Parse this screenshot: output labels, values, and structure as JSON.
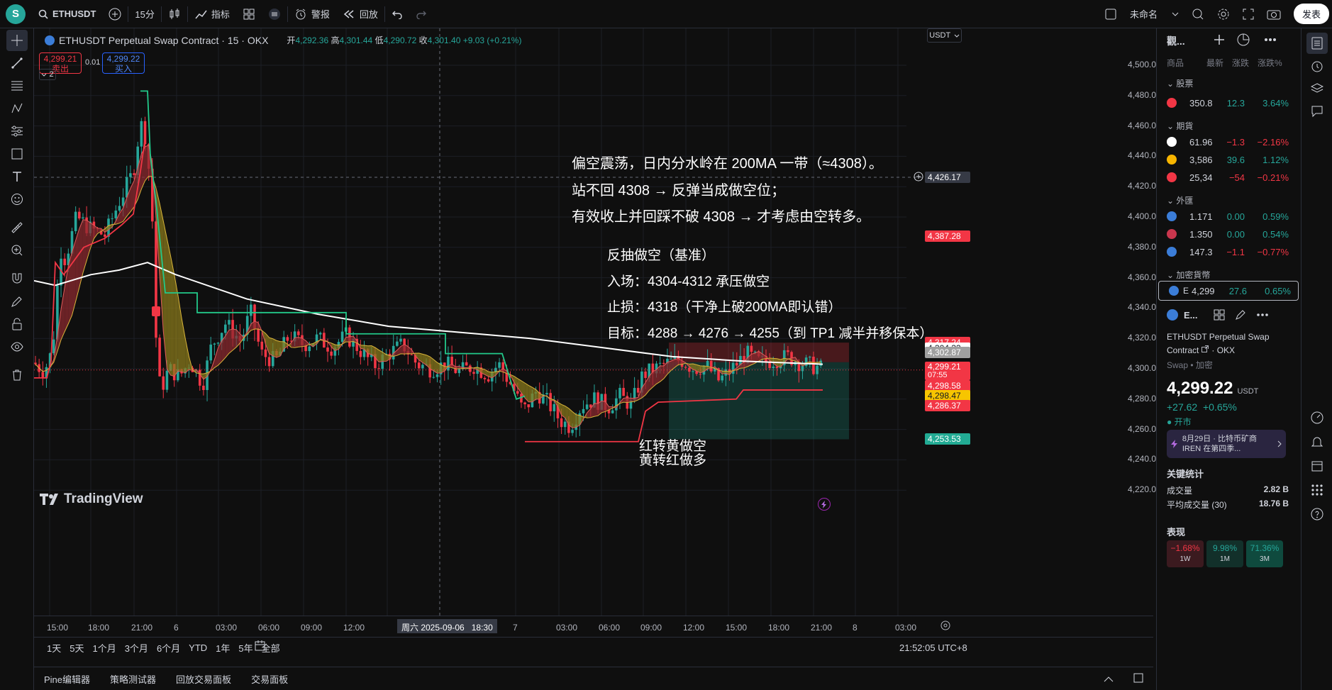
{
  "topbar": {
    "logo_letter": "S",
    "symbol": "ETHUSDT",
    "interval": "15分",
    "indicators": "指标",
    "alerts": "警报",
    "replay": "回放",
    "layout_name": "未命名",
    "publish": "发表"
  },
  "legend": {
    "title": "ETHUSDT Perpetual Swap Contract · 15 · OKX",
    "open_label": "开",
    "open": "4,292.36",
    "high_label": "高",
    "high": "4,301.44",
    "low_label": "低",
    "low": "4,290.72",
    "close_label": "收",
    "close": "4,301.40",
    "change": "+9.03 (+0.21%)",
    "sell_price": "4,299.21",
    "sell_label": "卖出",
    "spread": "0.01",
    "buy_price": "4,299.22",
    "buy_label": "买入",
    "indicators_count": "2",
    "currency": "USDT"
  },
  "price_axis": [
    "4,500.00",
    "4,480.00",
    "4,460.00",
    "4,440.00",
    "4,420.00",
    "4,400.00",
    "4,380.00",
    "4,360.00",
    "4,340.00",
    "4,320.00",
    "4,300.00",
    "4,280.00",
    "4,260.00",
    "4,240.00",
    "4,220.00"
  ],
  "price_tags": {
    "crosshair": "4,426.17",
    "t1": "4,387.28",
    "t2": "4,317.24",
    "t3": "4,304.33",
    "t4": "4,302.87",
    "t5": "4,299.21",
    "t5_countdown": "07:55",
    "t6": "4,298.58",
    "t7": "4,298.47",
    "t8": "4,286.37",
    "t9": "4,253.53"
  },
  "time_axis": [
    "15:00",
    "18:00",
    "21:00",
    "6",
    "03:00",
    "06:00",
    "09:00",
    "12:00",
    "15:00",
    "7",
    "03:00",
    "06:00",
    "09:00",
    "12:00",
    "15:00",
    "18:00",
    "21:00",
    "8",
    "03:00"
  ],
  "crosshair_time": "周六 2025-09-06   18:30",
  "ranges": [
    "1天",
    "5天",
    "1个月",
    "3个月",
    "6个月",
    "YTD",
    "1年",
    "5年",
    "全部"
  ],
  "clock": "21:52:05 UTC+8",
  "bottom_tabs": [
    "Pine编辑器",
    "策略测试器",
    "回放交易面板",
    "交易面板"
  ],
  "annotations": {
    "line1": "偏空震荡，日内分水岭在 200MA 一带（≈4308）。",
    "line2": "站不回 4308 → 反弹当成做空位；",
    "line3": "有效收上并回踩不破 4308 → 才考虑由空转多。",
    "plan_title": "反抽做空（基准）",
    "entry": "入场：4304-4312 承压做空",
    "stop": "止损：4318（干净上破200MA即认错）",
    "target": "目标：4288 → 4276 → 4255（到 TP1 减半并移保本）",
    "signal1": "红转黄做空",
    "signal2": "黄转红做多"
  },
  "tradingview_logo": "TradingView",
  "watchlist": {
    "title": "觀...",
    "cols": [
      "商品",
      "最新",
      "涨跌",
      "涨跌%"
    ],
    "groups": {
      "stocks": "股票",
      "futures": "期貨",
      "forex": "外匯",
      "crypto": "加密貨幣"
    },
    "rows": [
      {
        "last": "350.8",
        "chg": "12.3",
        "pct": "3.64%",
        "color": "#26a69a",
        "dot": "#f23645"
      },
      {
        "last": "61.96",
        "chg": "−1.3",
        "pct": "−2.16%",
        "color": "#f23645",
        "dot": "#ffffff"
      },
      {
        "last": "3,586",
        "chg": "39.6",
        "pct": "1.12%",
        "color": "#26a69a",
        "dot": "#f7b500"
      },
      {
        "last": "25,34",
        "chg": "−54",
        "pct": "−0.21%",
        "color": "#f23645",
        "dot": "#f23645"
      },
      {
        "last": "1.171",
        "chg": "0.00",
        "pct": "0.59%",
        "color": "#26a69a",
        "dot": "#3b7dd8"
      },
      {
        "last": "1.350",
        "chg": "0.00",
        "pct": "0.54%",
        "color": "#26a69a",
        "dot": "#c9364d"
      },
      {
        "last": "147.3",
        "chg": "−1.1",
        "pct": "−0.77%",
        "color": "#f23645",
        "dot": "#3b7dd8"
      },
      {
        "sym": "E",
        "last": "4,299",
        "chg": "27.6",
        "pct": "0.65%",
        "color": "#26a69a",
        "dot": "#3b7dd8"
      }
    ],
    "detail_sym": "E...",
    "detail_name": "ETHUSDT Perpetual Swap",
    "detail_contract": "Contract",
    "detail_exchange": "· OKX",
    "detail_type": "Swap • 加密",
    "price_main": "4,299.",
    "price_dec": "22",
    "price_ccy": "USDT",
    "change": "+27.62  +0.65%",
    "market_status": "● 开市",
    "news": "8月29日 · 比特币矿商 IREN 在第四季...",
    "stats_title": "关键统计",
    "volume_label": "成交量",
    "volume": "2.82 B",
    "avgvol_label": "平均成交量 (30)",
    "avgvol": "18.76 B",
    "perf_title": "表现",
    "perf": [
      {
        "v": "−1.68%",
        "p": "1W",
        "bg": "#3b1a1f",
        "c": "#f23645"
      },
      {
        "v": "9.98%",
        "p": "1M",
        "bg": "#12302a",
        "c": "#26a69a"
      },
      {
        "v": "71.36%",
        "p": "3M",
        "bg": "#0f4a3e",
        "c": "#26a69a"
      }
    ]
  },
  "colors": {
    "up": "#26a69a",
    "down": "#f23645",
    "ma200": "#ffffff",
    "step_green": "#22c98a",
    "step_red": "#f23645",
    "band_red": "#8b2a2f",
    "band_yellow": "#8a7a1c"
  }
}
